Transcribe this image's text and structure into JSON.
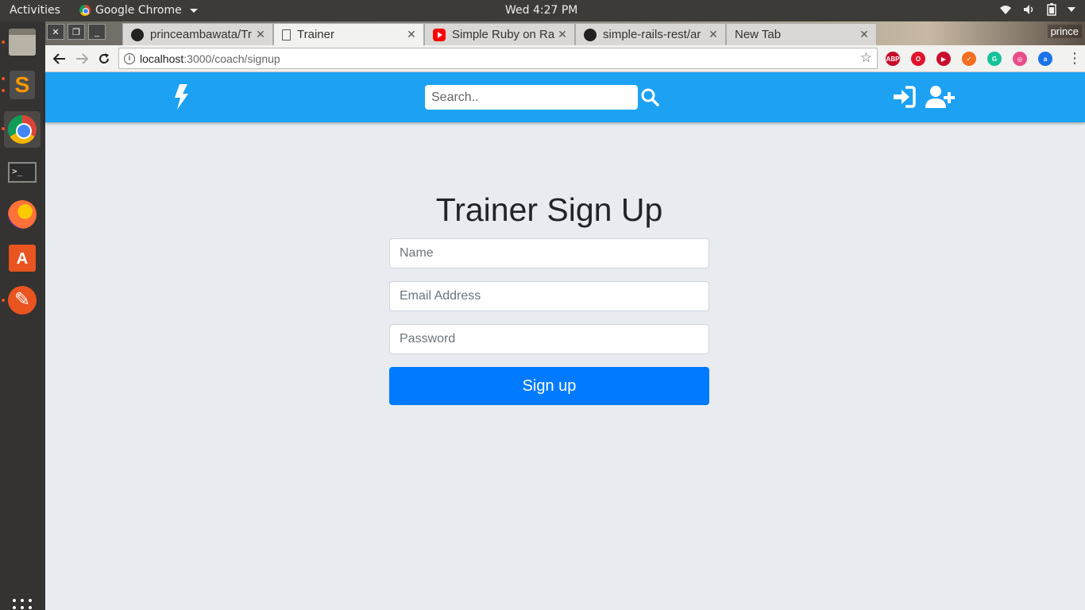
{
  "system": {
    "activities": "Activities",
    "app_name": "Google Chrome",
    "clock": "Wed  4:27 PM"
  },
  "launcher": {
    "items": [
      "files-icon",
      "sublime-text-icon",
      "chrome-icon",
      "terminal-icon",
      "firefox-icon",
      "software-center-icon",
      "inkscape-icon",
      "show-apps-icon"
    ]
  },
  "browser": {
    "tabs": [
      {
        "label": "princeambawata/Tr"
      },
      {
        "label": "Trainer"
      },
      {
        "label": "Simple Ruby on Rai"
      },
      {
        "label": "simple-rails-rest/ar"
      },
      {
        "label": "New Tab"
      }
    ],
    "profile": "prince",
    "url_host": "localhost",
    "url_path": ":3000/coach/signup",
    "extensions": [
      {
        "name": "abp-icon",
        "text": "ABP",
        "color": "#c70d2c"
      },
      {
        "name": "opera-icon",
        "text": "O",
        "color": "#e0142c"
      },
      {
        "name": "media-icon",
        "text": "▶",
        "color": "#c8102e"
      },
      {
        "name": "extension-icon",
        "text": "✓",
        "color": "#f36f21"
      },
      {
        "name": "grammarly-icon",
        "text": "G",
        "color": "#15c39a"
      },
      {
        "name": "dribbble-icon",
        "text": "◎",
        "color": "#ea4c89"
      },
      {
        "name": "a-icon",
        "text": "a",
        "color": "#1a73e8"
      }
    ]
  },
  "site": {
    "brand_color": "#1da1f2",
    "search_placeholder": "Search.."
  },
  "form": {
    "title": "Trainer Sign Up",
    "name_placeholder": "Name",
    "email_placeholder": "Email Address",
    "password_placeholder": "Password",
    "submit_label": "Sign up",
    "submit_color": "#007bff"
  }
}
